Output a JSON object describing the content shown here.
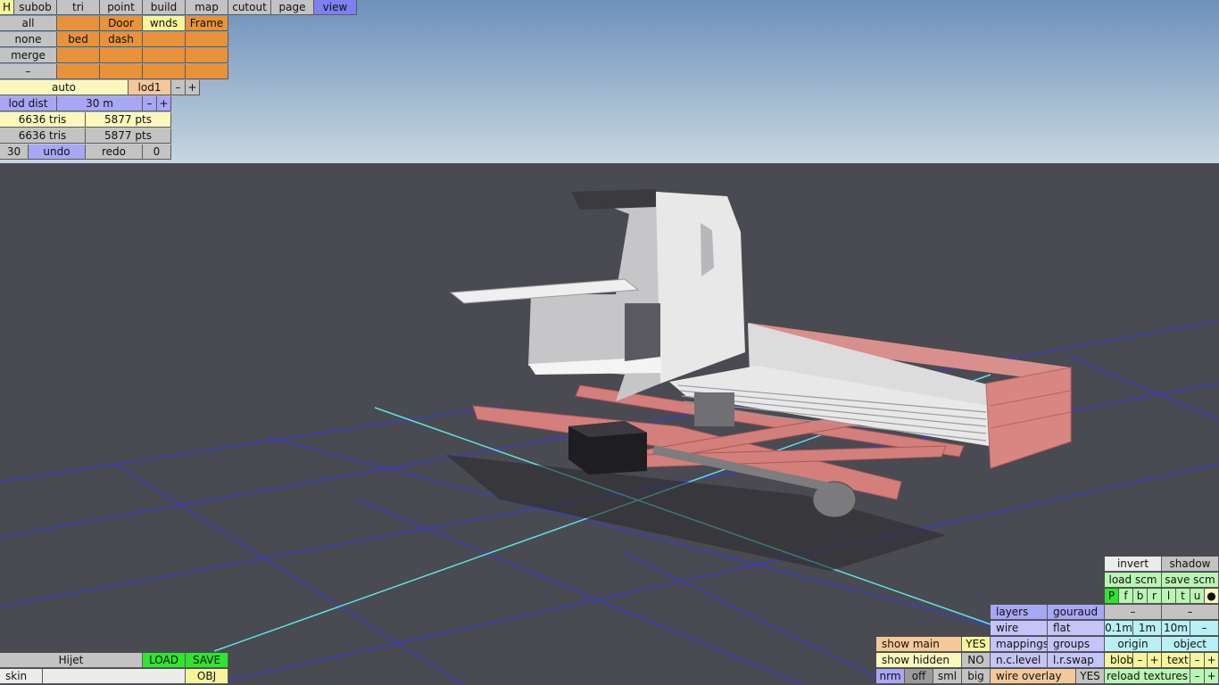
{
  "top_menu": [
    {
      "label": "H"
    },
    {
      "label": "subob"
    },
    {
      "label": "tri"
    },
    {
      "label": "point"
    },
    {
      "label": "build"
    },
    {
      "label": "map"
    },
    {
      "label": "cutout"
    },
    {
      "label": "page"
    },
    {
      "label": "view"
    }
  ],
  "groups": {
    "row1": [
      "all",
      "",
      "Door",
      "wnds",
      "Frame"
    ],
    "row2": [
      "none",
      "bed",
      "dash",
      "",
      ""
    ],
    "row3": [
      "merge",
      "",
      "",
      "",
      ""
    ],
    "row4": [
      "–",
      "",
      "",
      "",
      ""
    ]
  },
  "lod": {
    "auto": "auto",
    "level": "lod1",
    "minus": "–",
    "plus": "+"
  },
  "lod_dist": {
    "label": "lod dist",
    "value": "30 m",
    "minus": "–",
    "plus": "+"
  },
  "stats": [
    {
      "tris": "6636 tris",
      "pts": "5877 pts"
    },
    {
      "tris": "6636 tris",
      "pts": "5877 pts"
    }
  ],
  "undo_row": {
    "count": "30",
    "undo": "undo",
    "redo": "redo",
    "redo_count": "0"
  },
  "bottom_left": {
    "name": "Hijet",
    "load": "LOAD",
    "save": "SAVE",
    "skin": "skin",
    "skin_value": "",
    "obj": "OBJ"
  },
  "show_panel": {
    "show_main": "show main",
    "show_main_val": "YES",
    "show_hidden": "show hidden",
    "show_hidden_val": "NO",
    "nrm": "nrm",
    "off": "off",
    "sml": "sml",
    "big": "big"
  },
  "view_panel": {
    "layers": "layers",
    "gouraud": "gouraud",
    "wire": "wire",
    "flat": "flat",
    "mappings": "mappings",
    "groups": "groups",
    "nclevel": "n.c.level",
    "lrswap": "l.r.swap",
    "wire_overlay": "wire overlay",
    "wire_overlay_val": "YES"
  },
  "right_panel": {
    "invert": "invert",
    "shadow": "shadow",
    "load_scm": "load scm",
    "save_scm": "save scm",
    "views": [
      "P",
      "f",
      "b",
      "r",
      "l",
      "t",
      "u",
      "●"
    ],
    "dash1": "–",
    "dash2": "–",
    "scale": [
      "0.1m",
      "1m",
      "10m",
      "–"
    ],
    "origin": "origin",
    "object": "object",
    "blob": "blob",
    "blob_minus": "–",
    "blob_plus": "+",
    "text": "text",
    "text_minus": "–",
    "text_plus": "+",
    "reload": "reload textures",
    "reload_minus": "–",
    "reload_plus": "+"
  },
  "colors": {
    "sky_top": "#6f93bd",
    "sky_bottom": "#c3d3df",
    "floor": "#4a4a52",
    "grid": "#3b3bd8",
    "axis": "#5ce7e4",
    "frame": "#d77f7b",
    "cab": "#e6e6e6"
  }
}
